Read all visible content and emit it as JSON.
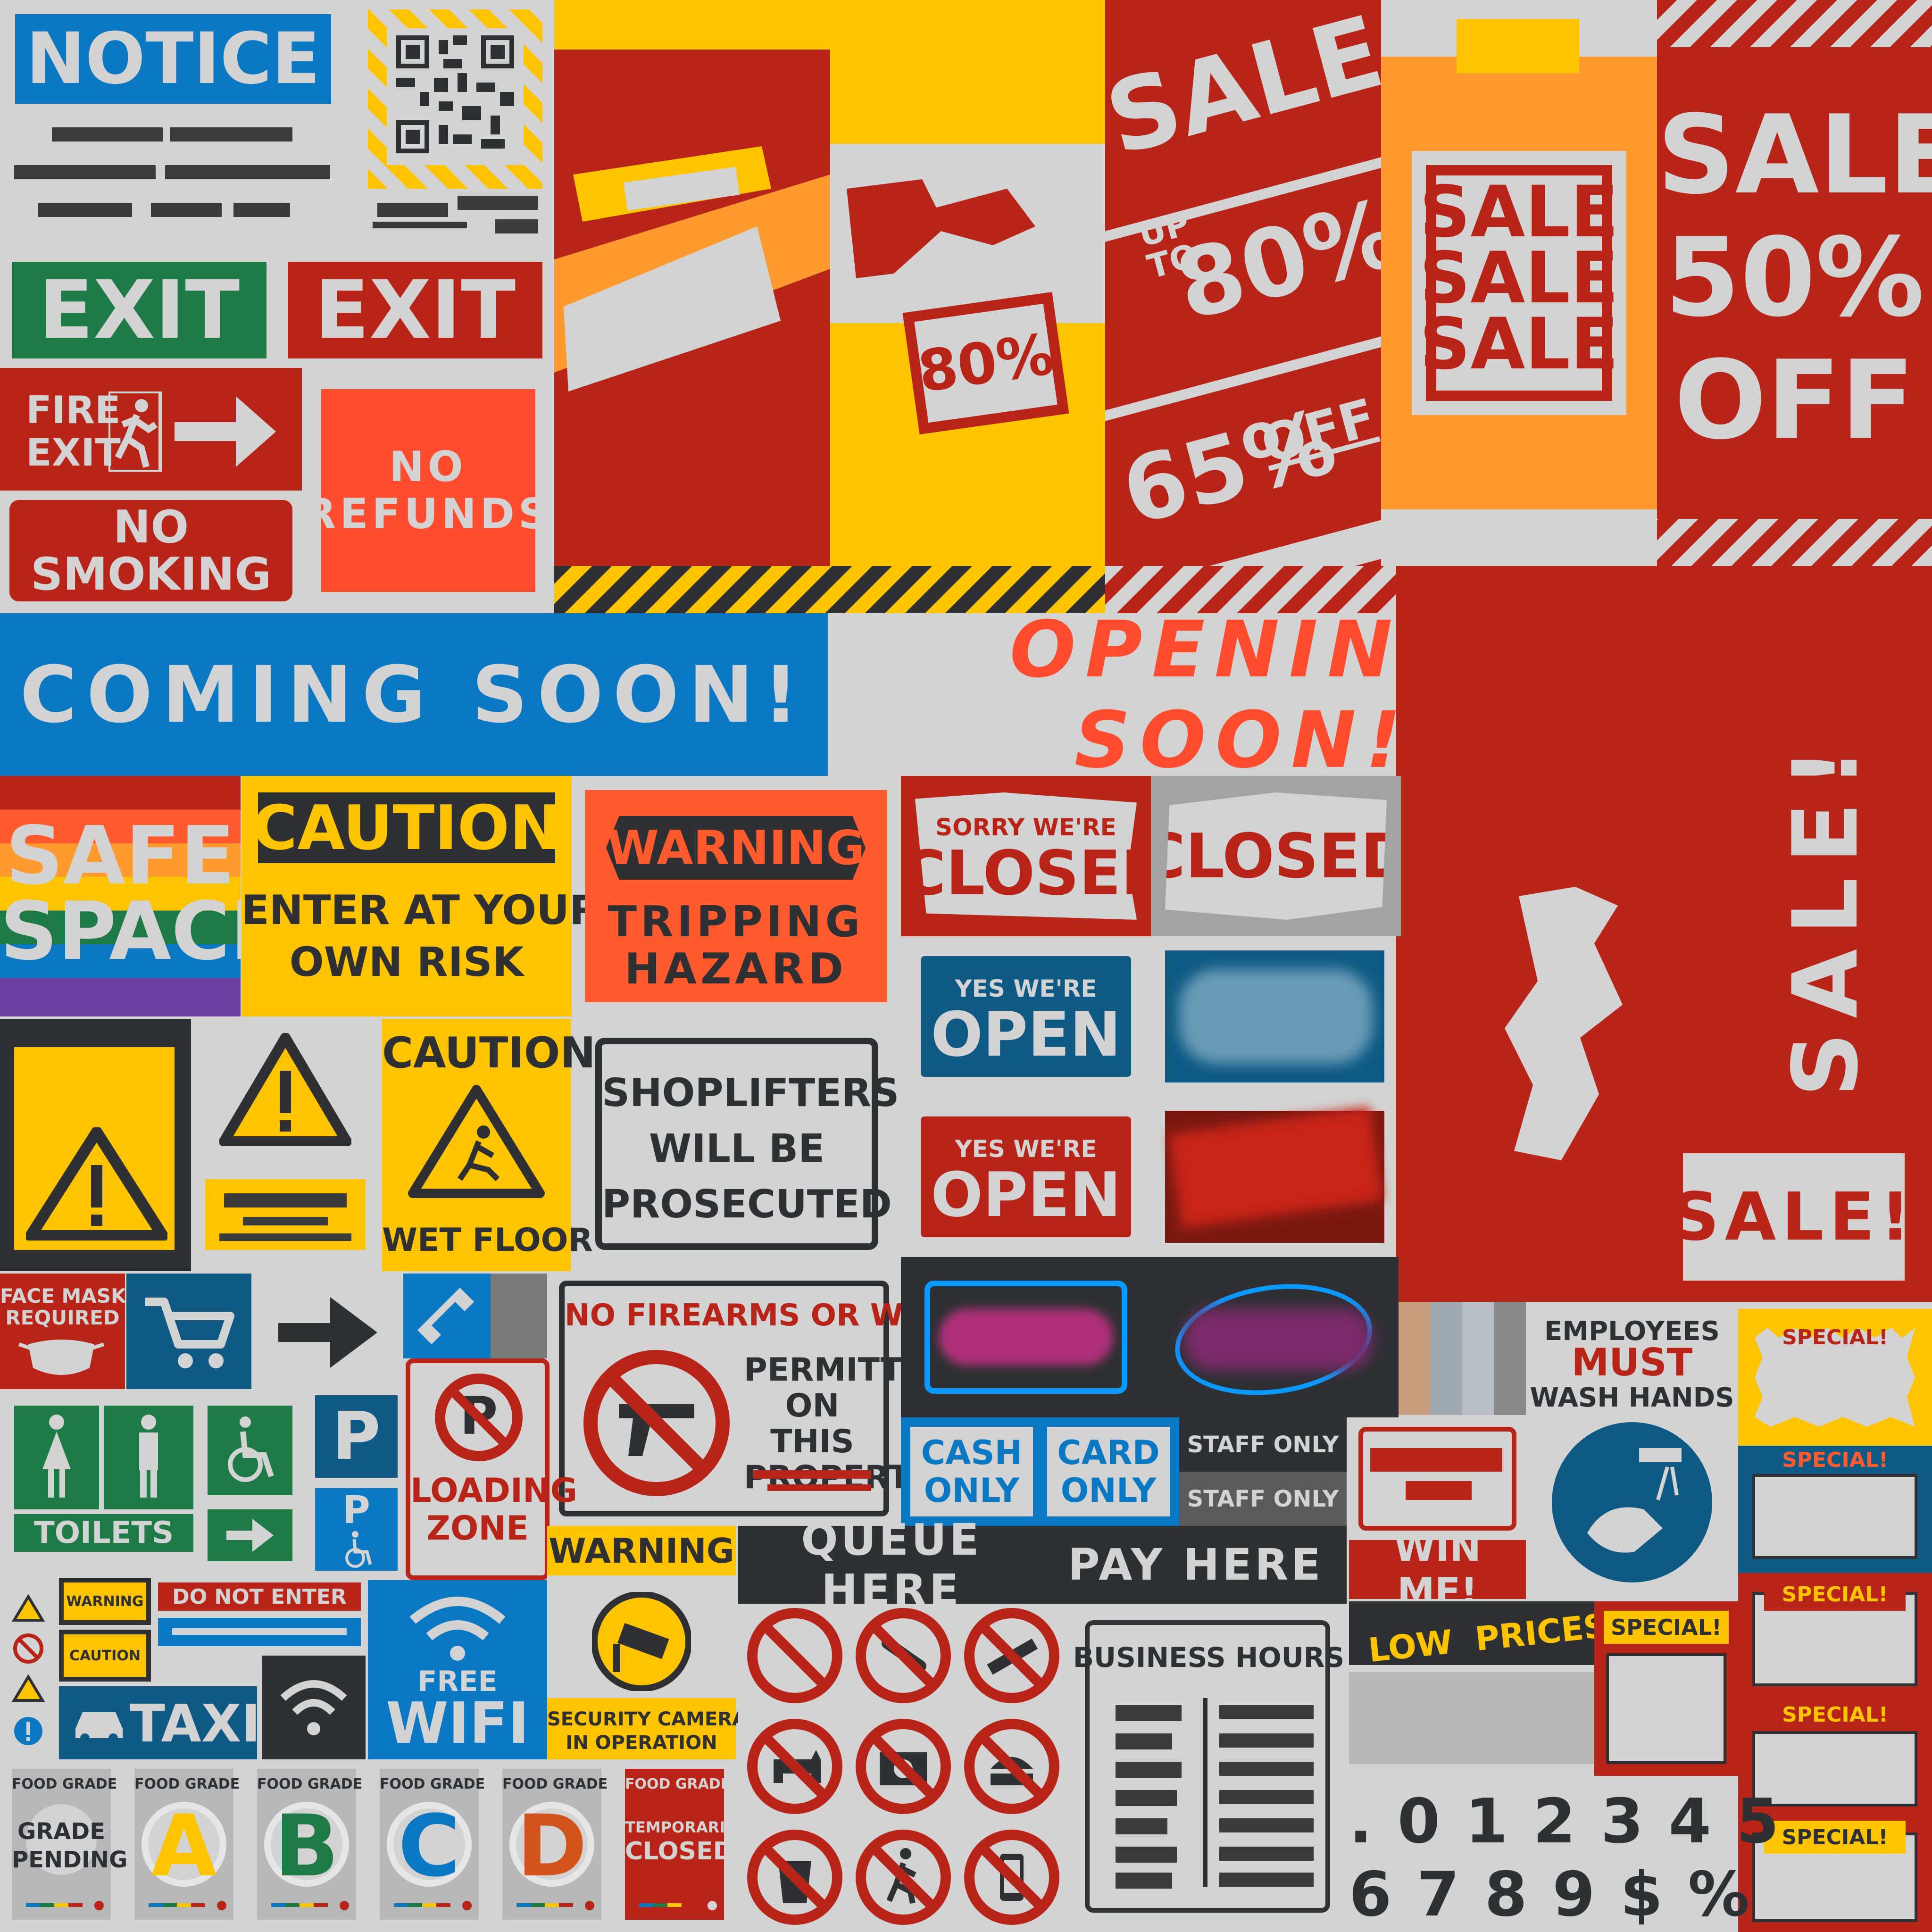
{
  "notice": {
    "label": "NOTICE"
  },
  "exit": {
    "green": "EXIT",
    "red": "EXIT"
  },
  "fire_exit": {
    "line1": "FIRE",
    "line2": "EXIT"
  },
  "no_smoking": {
    "line1": "NO",
    "line2": "SMOKING"
  },
  "no_refunds": {
    "line1": "NO",
    "line2": "REFUNDS"
  },
  "sale_banners": {
    "sale": "SALE",
    "up": "UP",
    "to": "TO",
    "eighty": "80%",
    "sixty_five": "65%",
    "off": "OFF",
    "sale1": "SALE",
    "sale2": "SALE",
    "sale3": "SALE",
    "fifty_sale": "SALE",
    "fifty": "50%",
    "fifty_off": "OFF",
    "sticker80": "80%"
  },
  "coming_soon": "COMING SOON!",
  "opening_soon": "OPENING SOON!",
  "vertical_sale": "SALE!",
  "sale_box": "SALE!",
  "safe_space": {
    "line1": "SAFE",
    "line2": "SPACE"
  },
  "caution_risk": {
    "header": "CAUTION",
    "line1": "ENTER AT YOUR",
    "line2": "OWN RISK"
  },
  "warning_trip": {
    "header": "WARNING",
    "line1": "TRIPPING",
    "line2": "HAZARD"
  },
  "sorry_closed": {
    "small": "SORRY WE'RE",
    "big": "CLOSED"
  },
  "closed": "CLOSED",
  "open_blue": {
    "small": "YES WE'RE",
    "big": "OPEN"
  },
  "open_red": {
    "small": "YES WE'RE",
    "big": "OPEN"
  },
  "caution_floor": {
    "header": "CAUTION",
    "footer": "WET FLOOR"
  },
  "shoplifters": {
    "line1": "SHOPLIFTERS",
    "line2": "WILL BE",
    "line3": "PROSECUTED"
  },
  "face_mask": {
    "line1": "FACE MASK",
    "line2": "REQUIRED"
  },
  "firearms": {
    "header": "NO FIREARMS OR WEAPONS",
    "line1": "PERMITTED",
    "line2": "ON THIS",
    "line3": "PROPERTY"
  },
  "payment": {
    "cash1": "CASH",
    "cash2": "ONLY",
    "card1": "CARD",
    "card2": "ONLY"
  },
  "staff_only": {
    "a": "STAFF ONLY",
    "b": "STAFF ONLY"
  },
  "employees": {
    "line1": "EMPLOYEES",
    "line2": "MUST",
    "line3": "WASH HANDS"
  },
  "specials": [
    "SPECIAL!",
    "SPECIAL!",
    "SPECIAL!",
    "SPECIAL!",
    "SPECIAL!",
    "SPECIAL!"
  ],
  "toilets": "TOILETS",
  "parking": {
    "p1": "P",
    "p2": "P"
  },
  "loading_zone": {
    "line1": "LOADING",
    "line2": "ZONE"
  },
  "security": {
    "header": "WARNING",
    "line1": "SECURITY CAMERAS",
    "line2": "IN OPERATION"
  },
  "queue_here": "QUEUE HERE",
  "pay_here": "PAY HERE",
  "win_me": "WIN ME!",
  "low_prices": {
    "a": "LOW",
    "b": "PRICES!"
  },
  "mini": {
    "warning": "WARNING",
    "caution": "CAUTION",
    "do_not_enter": "DO NOT ENTER"
  },
  "taxi": "TAXI",
  "wifi": {
    "line1": "FREE",
    "line2": "WIFI"
  },
  "business_hours": "BUSINESS HOURS",
  "food_grades": [
    {
      "head": "FOOD GRADE",
      "grade": "GRADE",
      "sub": "PENDING"
    },
    {
      "head": "FOOD GRADE",
      "grade": "A"
    },
    {
      "head": "FOOD GRADE",
      "grade": "B"
    },
    {
      "head": "FOOD GRADE",
      "grade": "C"
    },
    {
      "head": "FOOD GRADE",
      "grade": "D"
    },
    {
      "head": "FOOD GRADE",
      "grade": "TEMPORARILY",
      "sub": "CLOSED"
    }
  ],
  "digits": {
    "row1": ". 0 1 2 3 4 5",
    "row2": "6 7 8 9 $ %"
  },
  "colors": {
    "red": "#b92418",
    "blue": "#0a78c2",
    "yellow": "#ffc400",
    "green": "#1e7a47",
    "orange": "#ff5a2e",
    "dark": "#2e3033",
    "light": "#d3d3d3"
  }
}
